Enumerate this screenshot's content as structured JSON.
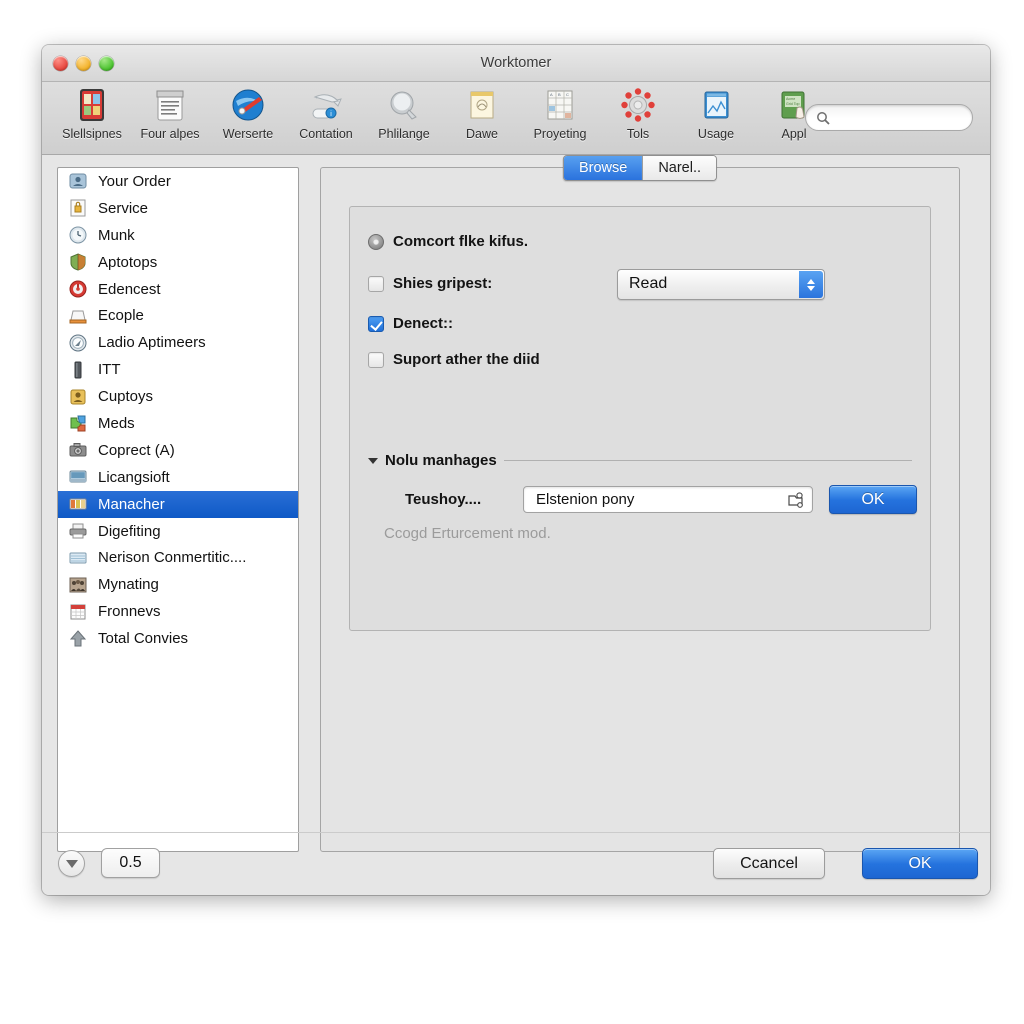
{
  "window": {
    "title": "Worktomer",
    "traffic_lights": [
      "close-button",
      "minimize-button",
      "maximize-button"
    ]
  },
  "colors": {
    "accent_blue": "#2573de",
    "selection_blue": "#0f59c6",
    "window_bg": "#e6e6e6",
    "toolbar_bg": "#d6d6d6",
    "list_bg": "#ffffff",
    "group_bg": "#dedede",
    "hint_gray": "#9b9b9b"
  },
  "toolbar": {
    "items": [
      {
        "label": "Slellsipnes",
        "icon": "device-grid-icon"
      },
      {
        "label": "Four alpes",
        "icon": "document-list-icon"
      },
      {
        "label": "Werserte",
        "icon": "blue-sphere-icon"
      },
      {
        "label": "Contation",
        "icon": "sync-arrow-icon"
      },
      {
        "label": "Phlilange",
        "icon": "gray-balloon-icon"
      },
      {
        "label": "Dawe",
        "icon": "note-page-icon"
      },
      {
        "label": "Proyeting",
        "icon": "spreadsheet-icon"
      },
      {
        "label": "Tols",
        "icon": "red-gear-icon"
      },
      {
        "label": "Usage",
        "icon": "blue-window-icon"
      },
      {
        "label": "Appl",
        "icon": "green-card-hand-icon"
      }
    ],
    "search": {
      "value": "",
      "placeholder": "",
      "icon": "search-icon"
    }
  },
  "sidebar": {
    "items": [
      {
        "label": "Your Order",
        "icon": "user-badge-icon"
      },
      {
        "label": "Service",
        "icon": "lock-page-icon"
      },
      {
        "label": "Munk",
        "icon": "clock-icon"
      },
      {
        "label": "Aptotops",
        "icon": "shield-icon"
      },
      {
        "label": "Edencest",
        "icon": "red-power-icon"
      },
      {
        "label": "Ecople",
        "icon": "printer-tray-icon"
      },
      {
        "label": "Ladio Aptimeers",
        "icon": "compass-icon"
      },
      {
        "label": "ITT",
        "icon": "drive-bar-icon"
      },
      {
        "label": "Cuptoys",
        "icon": "person-money-icon"
      },
      {
        "label": "Meds",
        "icon": "puzzle-icon"
      },
      {
        "label": "Coprect (A)",
        "icon": "camera-icon"
      },
      {
        "label": "Licangsioft",
        "icon": "display-icon"
      },
      {
        "label": "Manacher",
        "icon": "books-icon",
        "selected": true
      },
      {
        "label": "Digefiting",
        "icon": "printer-icon"
      },
      {
        "label": "Nerison Conmertitic....",
        "icon": "window-stripes-icon"
      },
      {
        "label": "Mynating",
        "icon": "people-group-icon"
      },
      {
        "label": "Fronnevs",
        "icon": "calendar-icon"
      },
      {
        "label": "Total Convies",
        "icon": "upload-arrow-icon"
      }
    ]
  },
  "pane": {
    "tabs": [
      {
        "label": "Browse",
        "selected": true
      },
      {
        "label": "Narel..",
        "selected": false
      }
    ],
    "controls": {
      "radio_row": {
        "label": "Comcort flke kifus.",
        "type": "radio",
        "checked": true
      },
      "checkbox_row_1": {
        "label": "Shies gripest:",
        "type": "checkbox",
        "checked": false
      },
      "popup": {
        "value": "Read",
        "options": [
          "Read"
        ],
        "icon": "updown-stepper-icon"
      },
      "checkbox_row_2": {
        "label": "Denect::",
        "type": "checkbox",
        "checked": true
      },
      "checkbox_row_3": {
        "label": "Suport ather the diid",
        "type": "checkbox",
        "checked": false
      }
    },
    "section": {
      "title": "Nolu manhages",
      "disclosure": "expanded",
      "icon": "disclosure-triangle-icon"
    },
    "path_row": {
      "label": "Teushoy....",
      "field_value": "Elstenion pony",
      "field_placeholder": "",
      "field_icon": "choose-folder-icon",
      "ok_label": "OK"
    },
    "hint": "Ccogd Erturcement mod."
  },
  "footer": {
    "disclosure_icon": "disclosure-down-icon",
    "step_value": "0.5",
    "cancel_label": "Ccancel",
    "ok_label": "OK"
  }
}
